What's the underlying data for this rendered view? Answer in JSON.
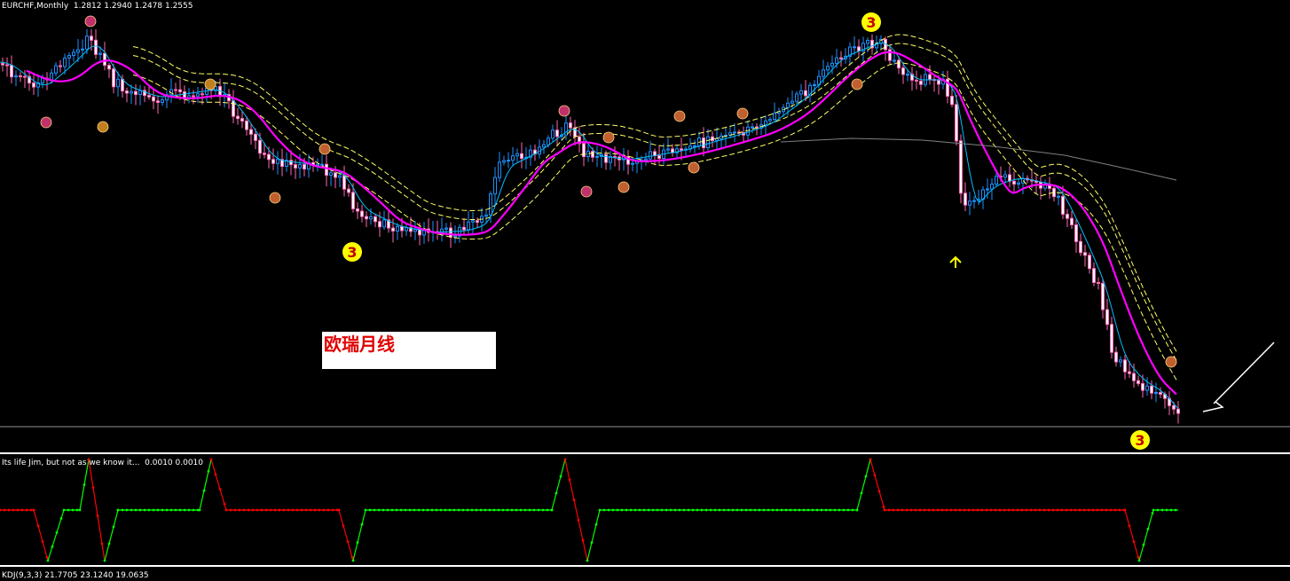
{
  "main_title": "EURCHF,Monthly  1.2812 1.2940 1.2478 1.2555",
  "oscillator_title": "Its life Jim, but not as we know it...  0.0010 0.0010",
  "kdj_title": "KDJ(9,3,3) 21.7705 23.1240 19.0635",
  "annotation_text": "欧瑞月线",
  "wave_markers": [
    "3",
    "3",
    "3"
  ],
  "colors": {
    "background": "#000000",
    "bull_candle": "#1e90ff",
    "bear_candle": "#ff69b4",
    "ma_fast": "#00bfff",
    "ma_slow": "#ff00ff",
    "envelope": "#ffff66",
    "long_ma": "#808080",
    "osc_up": "#00ff00",
    "osc_down": "#ff0000",
    "marker": "#ffff00"
  },
  "chart_data": {
    "type": "candlestick",
    "symbol": "EURCHF",
    "timeframe": "Monthly",
    "last_bar": {
      "open": 1.2812,
      "high": 1.294,
      "low": 1.2478,
      "close": 1.2555
    },
    "series": [
      {
        "name": "Its life Jim, but not as we know it...",
        "type": "step-oscillator",
        "values": [
          0.001,
          0.001
        ]
      },
      {
        "name": "KDJ(9,3,3)",
        "values": [
          21.7705,
          23.124,
          19.0635
        ]
      }
    ],
    "grid": false
  }
}
